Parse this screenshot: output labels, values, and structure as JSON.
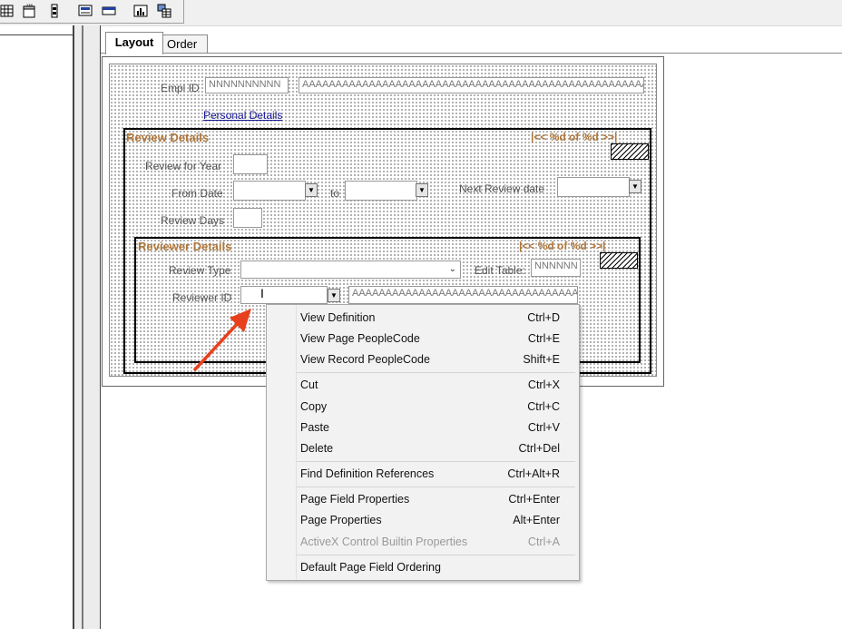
{
  "tabs": [
    {
      "label": "Layout",
      "active": true
    },
    {
      "label": "Order",
      "active": false
    }
  ],
  "toolbar": {
    "icons": [
      "grid-icon",
      "xml-page-icon",
      "scroll-icon",
      "page-field-icon",
      "grid-field-icon",
      "chart-icon",
      "component-icon"
    ]
  },
  "page": {
    "empl_id_label": "Empl ID",
    "empl_id_value": "NNNNNNNNNN",
    "name_value": "AAAAAAAAAAAAAAAAAAAAAAAAAAAAAAAAAAAAAAAAAAAAAAAAAAAAAAAAAA",
    "personal_details_link": "Personal Details",
    "review_group": {
      "title": "Review Details",
      "nav": "|<< %d of %d >>|",
      "review_for_year_label": "Review for Year",
      "from_date_label": "From Date",
      "to_label": "to",
      "next_review_date_label": "Next Review date",
      "review_days_label": "Review Days"
    },
    "reviewer_group": {
      "title": "Reviewer Details",
      "nav": "|<< %d of %d >>|",
      "review_type_label": "Review Type",
      "edit_table_label": "Edit Table:",
      "edit_table_value": "NNNNNN",
      "reviewer_id_label": "Reviewer ID",
      "reviewer_name_value": "AAAAAAAAAAAAAAAAAAAAAAAAAAAAAAAAAAA"
    }
  },
  "context_menu": {
    "items": [
      {
        "label": "View Definition",
        "shortcut": "Ctrl+D",
        "disabled": false
      },
      {
        "label": "View Page PeopleCode",
        "shortcut": "Ctrl+E",
        "disabled": false
      },
      {
        "label": "View Record PeopleCode",
        "shortcut": "Shift+E",
        "disabled": false
      },
      {
        "label": "Cut",
        "shortcut": "Ctrl+X",
        "disabled": false
      },
      {
        "label": "Copy",
        "shortcut": "Ctrl+C",
        "disabled": false
      },
      {
        "label": "Paste",
        "shortcut": "Ctrl+V",
        "disabled": false
      },
      {
        "label": "Delete",
        "shortcut": "Ctrl+Del",
        "disabled": false
      },
      {
        "label": "Find Definition References",
        "shortcut": "Ctrl+Alt+R",
        "disabled": false
      },
      {
        "label": "Page Field Properties",
        "shortcut": "Ctrl+Enter",
        "disabled": false
      },
      {
        "label": "Page Properties",
        "shortcut": "Alt+Enter",
        "disabled": false
      },
      {
        "label": "ActiveX Control Builtin Properties",
        "shortcut": "Ctrl+A",
        "disabled": true
      },
      {
        "label": "Default Page Field Ordering",
        "shortcut": "",
        "disabled": false
      }
    ]
  },
  "colors": {
    "group_title": "#b0773a",
    "link": "#1a1a9a",
    "annotation_arrow": "#e8401c"
  }
}
